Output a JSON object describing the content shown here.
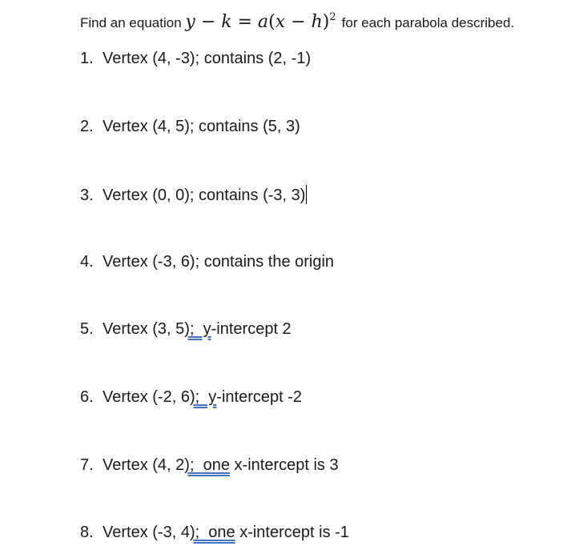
{
  "intro": {
    "before": "Find an equation",
    "equation": {
      "lhs_y": "y",
      "minus1": "−",
      "k": "k",
      "eq": "=",
      "a": "a",
      "lparen": "(",
      "x": "x",
      "minus2": "−",
      "h": "h",
      "rparen": ")",
      "exp": "2"
    },
    "after": "for each parabola described."
  },
  "items": [
    {
      "num": "1.",
      "pre": "Vertex (4, -3); contains (2, -1)",
      "marked": "",
      "post": ""
    },
    {
      "num": "2.",
      "pre": "Vertex (4, 5); contains (5, 3)",
      "marked": "",
      "post": ""
    },
    {
      "num": "3.",
      "pre": "Vertex (0, 0); contains (-3, 3)",
      "marked": "",
      "post": ""
    },
    {
      "num": "4.",
      "pre": "Vertex (-3, 6); contains the origin",
      "marked": "",
      "post": ""
    },
    {
      "num": "5.",
      "pre": "Vertex (3, 5",
      "marked": ");  y",
      "post": "-intercept 2"
    },
    {
      "num": "6.",
      "pre": "Vertex (-2, 6",
      "marked": ");  y",
      "post": "-intercept -2"
    },
    {
      "num": "7.",
      "pre": "Vertex (4, 2",
      "marked": ");  one",
      "post": " x-intercept is 3"
    },
    {
      "num": "8.",
      "pre": "Vertex (-3, 4",
      "marked": ");  one",
      "post": " x-intercept is -1"
    }
  ]
}
